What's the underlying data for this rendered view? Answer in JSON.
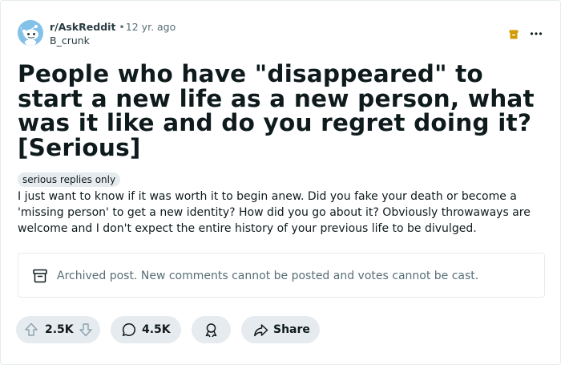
{
  "post": {
    "subreddit": "r/AskReddit",
    "separator": "•",
    "age": "12 yr. ago",
    "author": "B_crunk",
    "title": "People who have \"disappeared\" to start a new life as a new person, what was it like and do you regret doing it? [Serious]",
    "flair": "serious replies only",
    "body": "I just want to know if it was worth it to begin anew. Did you fake your death or become a 'missing person' to get a new identity? How did you go about it? Obviously throwaways are welcome and I don't expect the entire history of your previous life to be divulged.",
    "archived_notice": "Archived post. New comments cannot be posted and votes cannot be cast."
  },
  "actions": {
    "score": "2.5K",
    "comments": "4.5K",
    "share_label": "Share"
  },
  "icons": {
    "avatar": "reddit-snoo-avatar",
    "archived_badge": "archive-box-icon",
    "more": "ellipsis-icon",
    "archive_notice": "archive-box-icon",
    "upvote": "arrow-up-icon",
    "downvote": "arrow-down-icon",
    "comment": "speech-bubble-icon",
    "award": "award-ribbon-icon",
    "share": "share-arrow-icon"
  },
  "colors": {
    "accent_archive": "#d39900",
    "pill_bg": "#e5ebee",
    "muted_text": "#576f76",
    "avatar_bg": "#84c1e8"
  }
}
